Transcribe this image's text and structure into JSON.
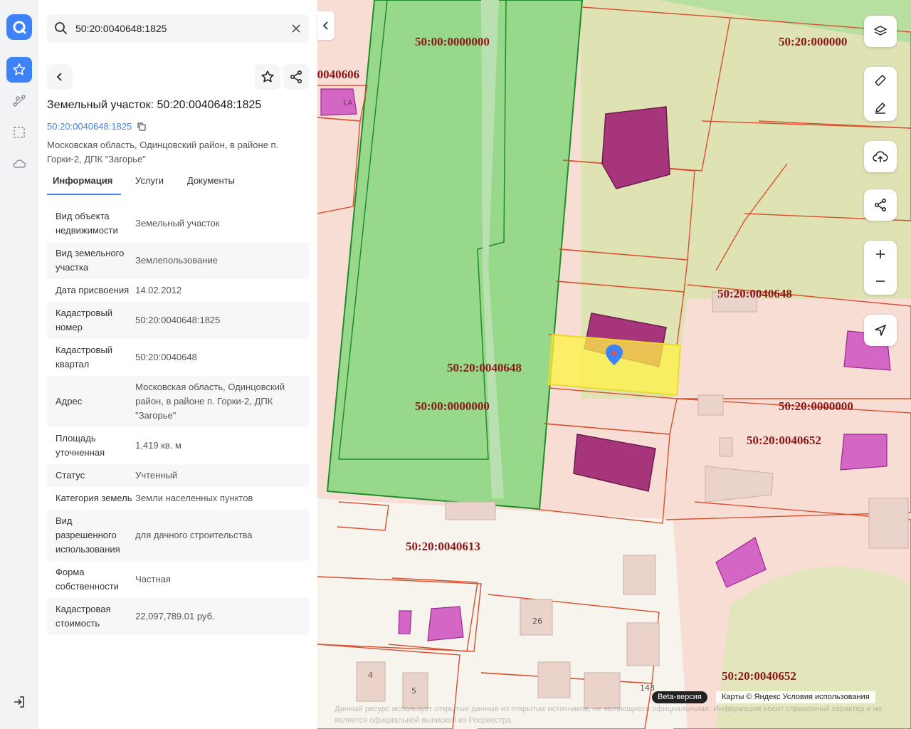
{
  "search": {
    "value": "50:20:0040648:1825"
  },
  "object": {
    "title": "Земельный участок: 50:20:0040648:1825",
    "cad_number": "50:20:0040648:1825",
    "address": "Московская область, Одинцовский район, в районе п. Горки-2, ДПК \"Загорье\""
  },
  "tabs": [
    "Информация",
    "Услуги",
    "Документы"
  ],
  "info_rows": [
    {
      "label": "Вид объекта недвижимости",
      "value": "Земельный участок"
    },
    {
      "label": "Вид земельного участка",
      "value": "Землепользование"
    },
    {
      "label": "Дата присвоения",
      "value": "14.02.2012"
    },
    {
      "label": "Кадастровый номер",
      "value": "50:20:0040648:1825"
    },
    {
      "label": "Кадастровый квартал",
      "value": "50:20:0040648"
    },
    {
      "label": "Адрес",
      "value": "Московская область, Одинцовский район, в районе п. Горки-2, ДПК \"Загорье\""
    },
    {
      "label": "Площадь уточненная",
      "value": "1,419 кв. м"
    },
    {
      "label": "Статус",
      "value": "Учтенный"
    },
    {
      "label": "Категория земель",
      "value": "Земли населенных пунктов"
    },
    {
      "label": "Вид разрешенного использования",
      "value": "для дачного строительства"
    },
    {
      "label": "Форма собственности",
      "value": "Частная"
    },
    {
      "label": "Кадастровая стоимость",
      "value": "22,097,789.01 руб."
    }
  ],
  "map": {
    "labels": [
      "50:00:0000000",
      "50:20:000000",
      ":0040606",
      "50:20:0040648",
      "50:20:0040648",
      "50:00:0000000",
      "50:20:0000000",
      "50:20:0040652",
      "50:20:0040613",
      "50:20:0040652"
    ],
    "house_numbers": [
      "1А",
      "26",
      "4",
      "5",
      "143"
    ],
    "beta": "Beta-версия",
    "credit": "Карты © Яндекс   Условия использования",
    "disclaimer": "Данный ресурс использует открытые данные из открытых источников, не являющиеся официальными. Информация носит справочный характер и не является официальной выпиской из Росреестра."
  }
}
